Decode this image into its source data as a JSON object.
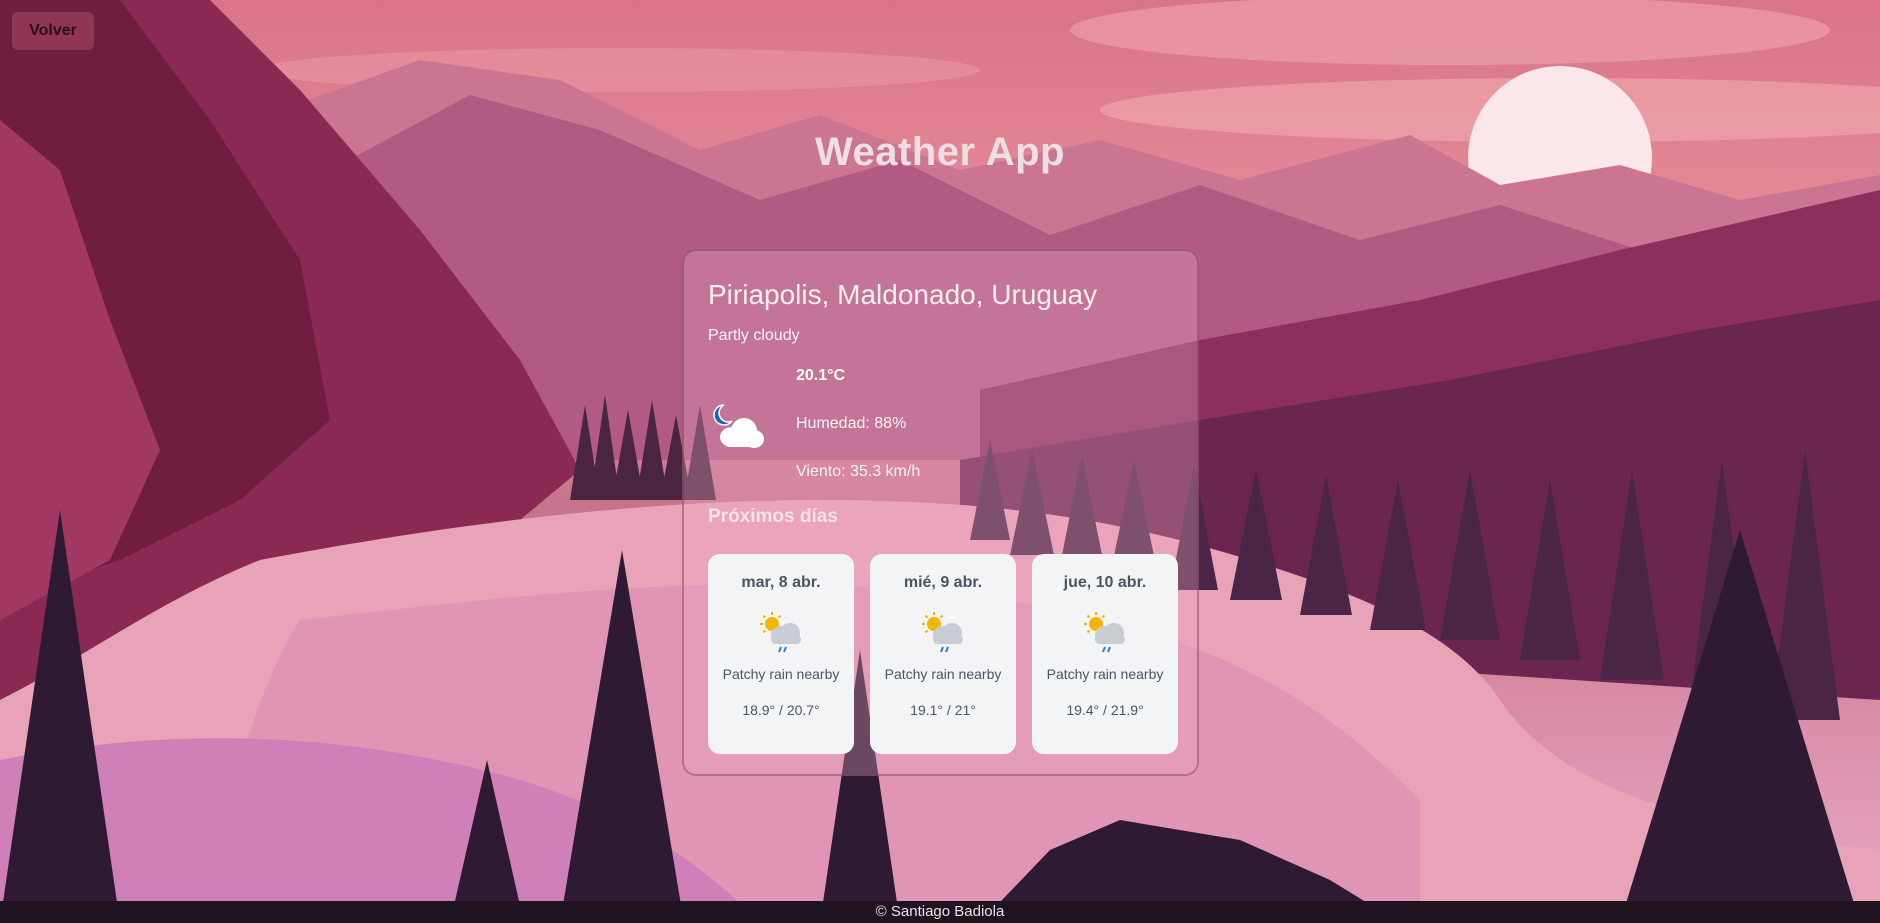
{
  "header": {
    "back_label": "Volver",
    "title": "Weather App"
  },
  "current": {
    "location": "Piriapolis, Maldonado, Uruguay",
    "condition": "Partly cloudy",
    "icon": "partly-cloudy-night-icon",
    "temperature": "20.1°C",
    "humidity": "Humedad: 88%",
    "wind": "Viento: 35.3 km/h"
  },
  "forecast": {
    "title": "Próximos días",
    "days": [
      {
        "date": "mar, 8 abr.",
        "icon": "patchy-rain-icon",
        "condition": "Patchy rain nearby",
        "range": "18.9° / 20.7°"
      },
      {
        "date": "mié, 9 abr.",
        "icon": "patchy-rain-icon",
        "condition": "Patchy rain nearby",
        "range": "19.1° / 21°"
      },
      {
        "date": "jue, 10 abr.",
        "icon": "patchy-rain-icon",
        "condition": "Patchy rain nearby",
        "range": "19.4° / 21.9°"
      }
    ]
  },
  "footer": {
    "credit": "© Santiago Badiola"
  },
  "colors": {
    "sky": "#e8909a",
    "mountain": "#8c2f5c",
    "trees": "#3a1c35",
    "card": "#f3f4f6"
  }
}
